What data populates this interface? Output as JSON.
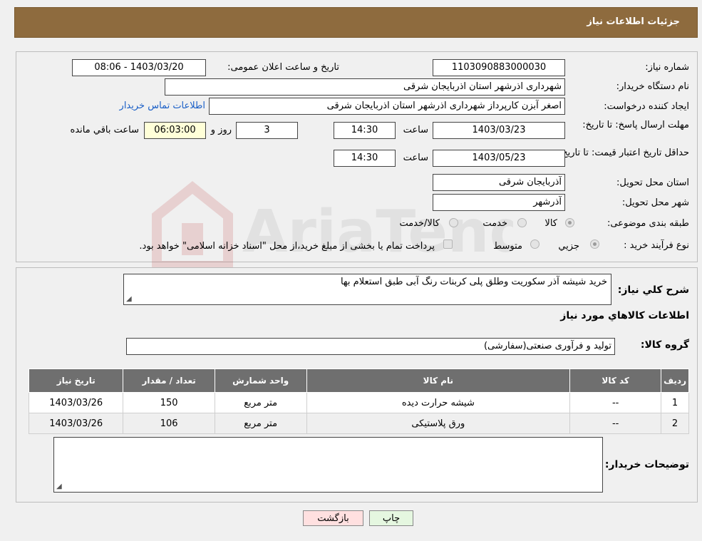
{
  "header": {
    "title": "جزئیات اطلاعات نیاز"
  },
  "form": {
    "need_number_label": "شماره نیاز:",
    "need_number": "1103090883000030",
    "announce_label": "تاریخ و ساعت اعلان عمومی:",
    "announce_value": "1403/03/20 - 08:06",
    "buyer_org_label": "نام دستگاه خریدار:",
    "buyer_org": "شهرداری اذرشهر استان اذربایجان شرقی",
    "creator_label": "ایجاد کننده درخواست:",
    "creator": "اصغر آبزن کارپرداز شهرداری اذرشهر استان اذربایجان شرقی",
    "contact_link": "اطلاعات تماس خریدار",
    "deadline_label": "مهلت ارسال پاسخ: تا تاریخ:",
    "deadline_date": "1403/03/23",
    "time_label": "ساعت",
    "deadline_time": "14:30",
    "days": "3",
    "days_label": "روز و",
    "remaining_time": "06:03:00",
    "remaining_label": "ساعت باقي مانده",
    "validity_label": "حداقل تاریخ اعتبار قیمت: تا تاریخ:",
    "validity_date": "1403/05/23",
    "validity_time": "14:30",
    "province_label": "استان محل تحویل:",
    "province": "آذربایجان شرقی",
    "city_label": "شهر محل تحویل:",
    "city": "آذرشهر",
    "category_label": "طبقه بندی موضوعی:",
    "category_options": [
      "کالا",
      "خدمت",
      "کالا/خدمت"
    ],
    "process_label": "نوع فرآیند خرید :",
    "process_options": [
      "جزیي",
      "متوسط"
    ],
    "process_note": "پرداخت تمام یا بخشی از مبلغ خرید،از محل \"اسناد خزانه اسلامی\" خواهد بود."
  },
  "details": {
    "summary_label": "شرح کلي نياز:",
    "summary": "خرید شیشه آذر سکوریت وطلق پلی کربنات رنگ آبی طبق استعلام بها",
    "goods_info_title": "اطلاعات کالاهاي مورد نياز",
    "goods_group_label": "گروه کالا:",
    "goods_group": "تولید و فرآوری صنعتی(سفارشی)",
    "table": {
      "headers": [
        "رديف",
        "کد کالا",
        "نام کالا",
        "واحد شمارش",
        "تعداد / مقدار",
        "تاریخ نیاز"
      ],
      "rows": [
        [
          "1",
          "--",
          "شیشه حرارت دیده",
          "متر مربع",
          "150",
          "1403/03/26"
        ],
        [
          "2",
          "--",
          "ورق پلاستیکی",
          "متر مربع",
          "106",
          "1403/03/26"
        ]
      ]
    },
    "buyer_notes_label": "توضیحات خریدار:",
    "buyer_notes": ""
  },
  "buttons": {
    "print": "چاپ",
    "back": "بازگشت"
  },
  "watermark": "AriaTender.neT",
  "colors": {
    "header": "#8e6b3e",
    "link": "#1a5fc7",
    "table_header": "#6f6f6f",
    "back_button": "#ffe0e0",
    "print_button": "#e5f7e0"
  }
}
